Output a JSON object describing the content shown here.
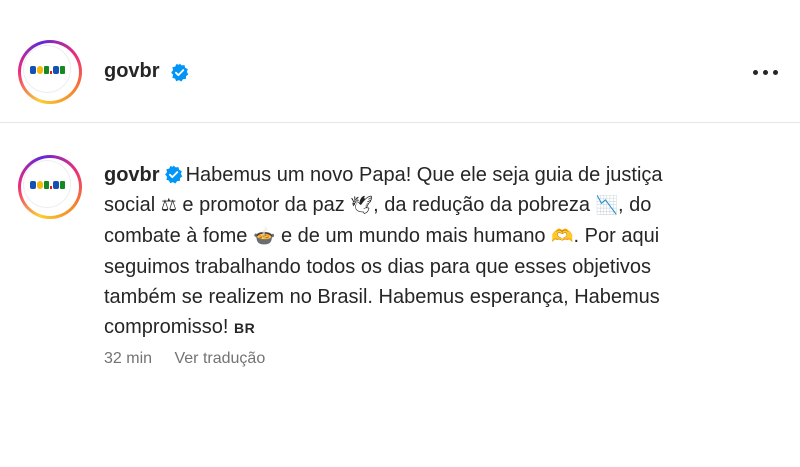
{
  "header": {
    "username": "govbr",
    "avatar_logo": "gov.br",
    "more_icon": "more-horizontal-icon"
  },
  "comment": {
    "username": "govbr",
    "avatar_logo": "gov.br",
    "text_segments": [
      "Habemus um novo Papa! Que ele seja guia de justiça",
      "social",
      "e promotor da paz",
      ", da redução da pobreza",
      ", do",
      "combate à fome",
      "e de um mundo mais humano",
      ". Por aqui",
      "seguimos trabalhando todos os dias para que esses objetivos",
      "também se realizem no Brasil. Habemus esperança, Habemus",
      "compromisso!"
    ],
    "flag": "BR",
    "emojis": {
      "scales": "⚖",
      "dove": "🕊",
      "chart_down": "📉",
      "bowl": "🍲",
      "heart_hands": "🫶"
    },
    "time": "32 min",
    "translate_label": "Ver tradução"
  },
  "colors": {
    "verified": "#0095f6",
    "text": "#262626",
    "muted": "#737373"
  }
}
